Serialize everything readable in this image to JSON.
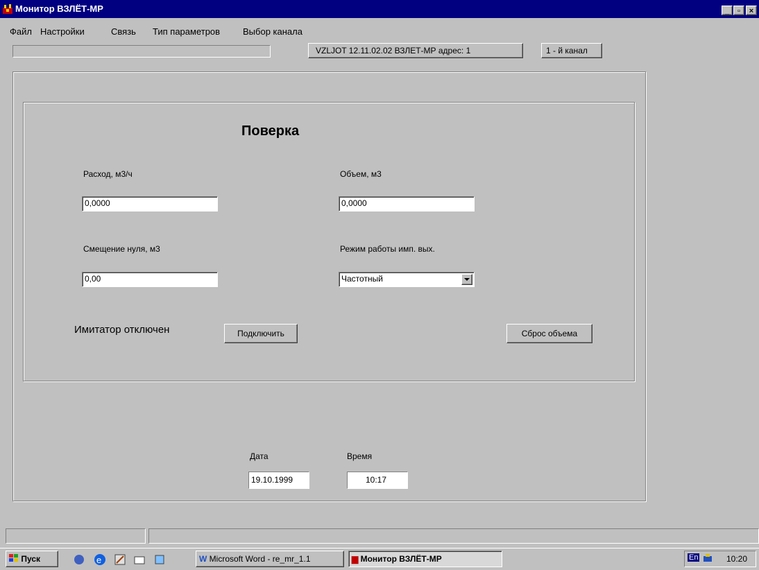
{
  "window": {
    "title": "Монитор ВЗЛЁТ-МР"
  },
  "window_controls": {
    "minimize": "_",
    "maximize": "▫",
    "close": "×"
  },
  "menu": [
    "Файл",
    "Настройки",
    "Связь",
    "Тип параметров",
    "Выбор канала"
  ],
  "status": {
    "device": "VZLJOT 12.11.02.02  ВЗЛЕТ-МР адрес: 1",
    "channel": "1 - й канал"
  },
  "panel": {
    "heading": "Поверка",
    "flow_label": "Расход, м3/ч",
    "flow_value": "0,0000",
    "volume_label": "Объем, м3",
    "volume_value": "0,0000",
    "zero_label": "Смещение нуля, м3",
    "zero_value": "0,00",
    "mode_label": "Режим работы имп. вых.",
    "mode_value": "Частотный",
    "simulator_status": "Имитатор отключен",
    "connect_button": "Подключить",
    "reset_button": "Сброс объема"
  },
  "datetime": {
    "date_label": "Дата",
    "date_value": "19.10.1999",
    "time_label": "Время",
    "time_value": "10:17"
  },
  "taskbar": {
    "start": "Пуск",
    "word_task": "Microsoft Word - re_mr_1.1",
    "app_task": "Монитор ВЗЛЁТ-МР",
    "lang": "En",
    "clock": "10:20"
  },
  "colors": {
    "title_bar": "#000080",
    "face": "#c0c0c0",
    "field": "#ffffff"
  },
  "icons": [
    "app-icon",
    "dropdown-arrow-icon",
    "start-windows-icon",
    "quicklaunch-icons",
    "word-icon",
    "volume-icon"
  ]
}
